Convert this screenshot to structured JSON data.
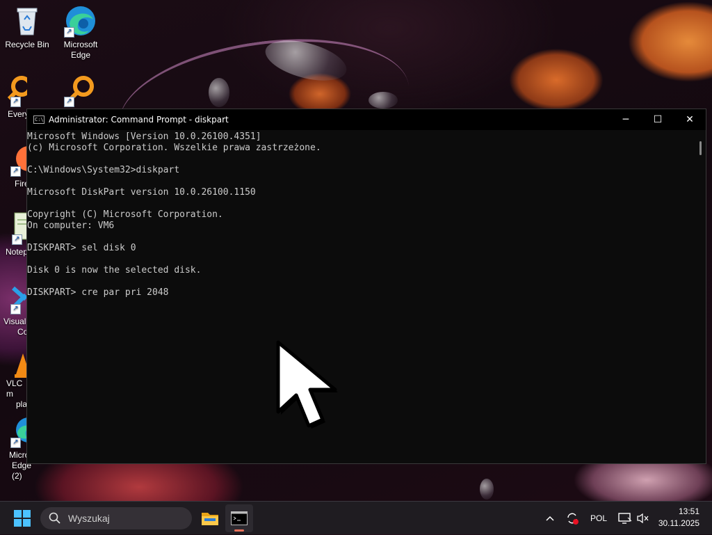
{
  "desktop": {
    "icons": [
      {
        "label": "Recycle Bin"
      },
      {
        "label": "Microsoft Edge"
      },
      {
        "label": "Every"
      },
      {
        "label": "Fire"
      },
      {
        "label": "Notep"
      },
      {
        "label": "Visual"
      },
      {
        "label": "Co"
      },
      {
        "label": "VLC m"
      },
      {
        "label": "pla"
      },
      {
        "label": "Micro"
      },
      {
        "label": "Edge (2)"
      }
    ]
  },
  "window": {
    "title": "Administrator: Command Prompt - diskpart",
    "icon_text": "C:\\",
    "controls": {
      "minimize": "─",
      "maximize": "☐",
      "close": "✕"
    },
    "console_lines": [
      "Microsoft Windows [Version 10.0.26100.4351]",
      "(c) Microsoft Corporation. Wszelkie prawa zastrzeżone.",
      "",
      "C:\\Windows\\System32>diskpart",
      "",
      "Microsoft DiskPart version 10.0.26100.1150",
      "",
      "Copyright (C) Microsoft Corporation.",
      "On computer: VM6",
      "",
      "DISKPART> sel disk 0",
      "",
      "Disk 0 is now the selected disk.",
      "",
      "DISKPART> cre par pri 2048"
    ]
  },
  "taskbar": {
    "search_placeholder": "Wyszukaj",
    "tray": {
      "chevron": "^",
      "language": "POL",
      "time": "13:51",
      "date": "30.11.2025"
    }
  },
  "colors": {
    "console_bg": "#0c0c0c",
    "console_text": "#cccccc",
    "taskbar_bg": "#1f1c21",
    "active_indicator": "#e8715a"
  }
}
